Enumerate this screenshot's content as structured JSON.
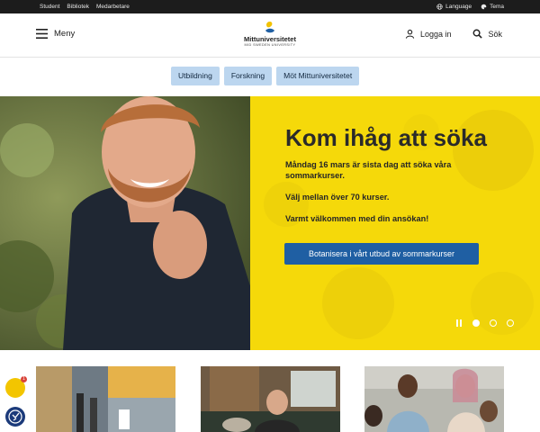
{
  "topbar": {
    "links": [
      "Student",
      "Bibliotek",
      "Medarbetare"
    ],
    "language": "Language",
    "theme": "Tema"
  },
  "header": {
    "menu_label": "Meny",
    "logo_name": "Mittuniversitetet",
    "logo_sub": "MID SWEDEN UNIVERSITY",
    "login_label": "Logga in",
    "search_label": "Sök"
  },
  "nav": {
    "pills": [
      "Utbildning",
      "Forskning",
      "Möt Mittuniversitetet"
    ]
  },
  "hero": {
    "title": "Kom ihåg att söka",
    "paragraphs": [
      "Måndag 16 mars är sista dag att söka våra sommarkurser.",
      "Välj mellan över 70 kurser.",
      "Varmt välkommen med din ansökan!"
    ],
    "cta": "Botanisera i vårt utbud av sommarkurser",
    "slides": 3,
    "active_slide": 1
  },
  "widgets": {
    "chat_badge": "1"
  },
  "colors": {
    "accent_yellow": "#f5d90a",
    "button_blue": "#1f5fa3",
    "pill_blue": "#bcd6ef",
    "topbar": "#1c1c1c"
  }
}
